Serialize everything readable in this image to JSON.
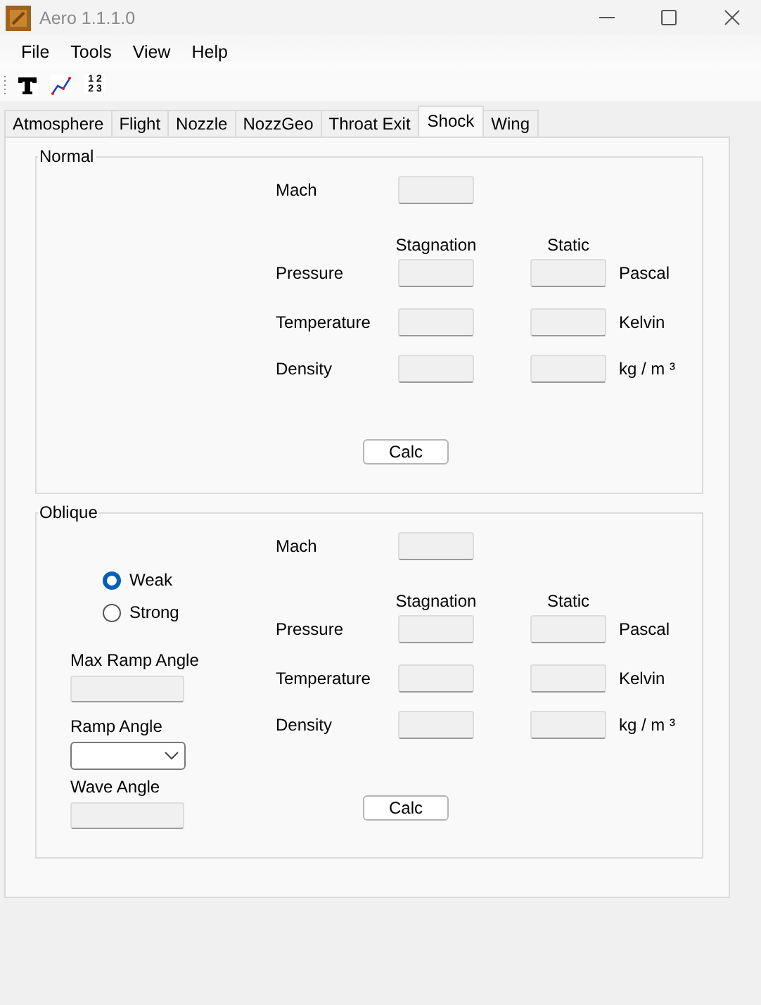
{
  "window": {
    "title": "Aero 1.1.1.0"
  },
  "menu": [
    "File",
    "Tools",
    "View",
    "Help"
  ],
  "toolbar": [
    {
      "kind": "text"
    },
    {
      "kind": "chart"
    },
    {
      "kind": "numbers",
      "lines": [
        "1 2",
        "2 3"
      ]
    }
  ],
  "tabs": [
    {
      "label": "Atmosphere",
      "selected": false
    },
    {
      "label": "Flight",
      "selected": false
    },
    {
      "label": "Nozzle",
      "selected": false
    },
    {
      "label": "NozzGeo",
      "selected": false
    },
    {
      "label": "Throat Exit",
      "selected": false
    },
    {
      "label": "Shock",
      "selected": true
    },
    {
      "label": "Wing",
      "selected": false
    }
  ],
  "groups": [
    {
      "title": "Normal",
      "mach_label": "Mach",
      "column_headers": [
        "Stagnation",
        "Static"
      ],
      "fields_disabled": true,
      "rows": [
        {
          "label": "Pressure",
          "unit": "Pascal"
        },
        {
          "label": "Temperature",
          "unit": "Kelvin"
        },
        {
          "label": "Density",
          "unit": "kg / m ³"
        }
      ],
      "button": "Calc"
    },
    {
      "title": "Oblique",
      "mach_label": "Mach",
      "column_headers": [
        "Stagnation",
        "Static"
      ],
      "fields_disabled": true,
      "rows": [
        {
          "label": "Pressure",
          "unit": "Pascal"
        },
        {
          "label": "Temperature",
          "unit": "Kelvin"
        },
        {
          "label": "Density",
          "unit": "kg / m ³"
        }
      ],
      "button": "Calc",
      "options": [
        {
          "label": "Weak",
          "selected": true
        },
        {
          "label": "Strong",
          "selected": false
        }
      ],
      "inputs": [
        {
          "kind": "field",
          "label": "Max Ramp Angle",
          "disabled": true
        },
        {
          "kind": "dropdown",
          "label": "Ramp Angle"
        },
        {
          "kind": "field",
          "label": "Wave Angle",
          "disabled": true
        }
      ]
    }
  ]
}
